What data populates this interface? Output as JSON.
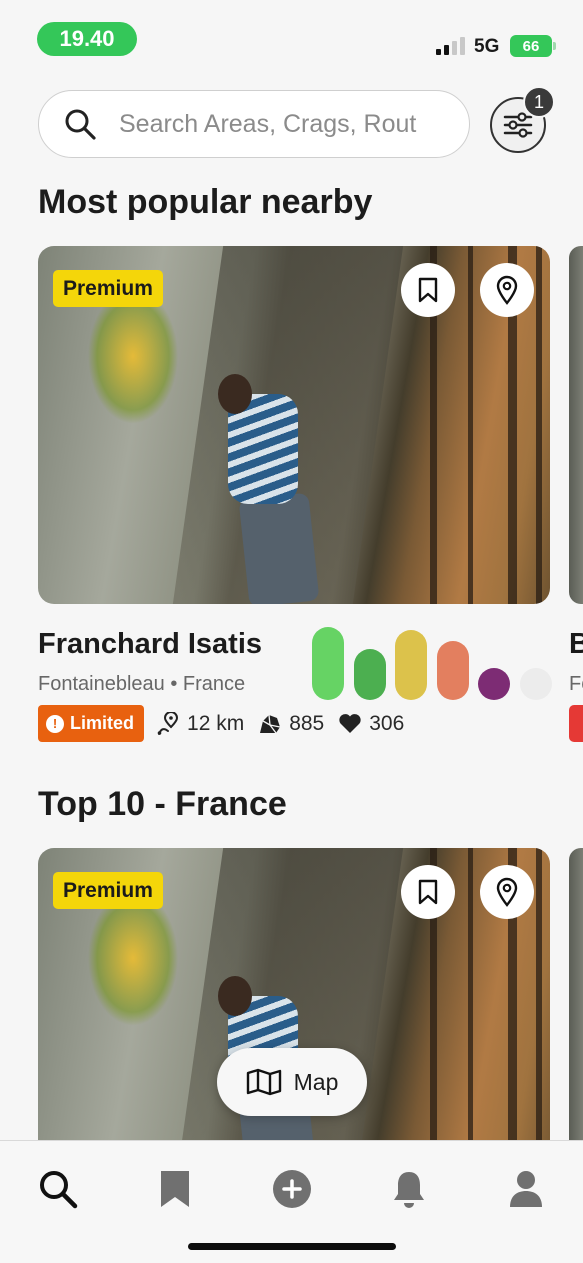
{
  "status_bar": {
    "time": "19.40",
    "network": "5G",
    "battery": "66"
  },
  "search": {
    "placeholder": "Search Areas, Crags, Rout",
    "filter_count": "1"
  },
  "sections": {
    "popular_title": "Most popular nearby",
    "top10_title": "Top 10 - France"
  },
  "card": {
    "premium_label": "Premium",
    "title": "Franchard Isatis",
    "subtitle": "Fontainebleau • France",
    "status_label": "Limited",
    "distance": "12 km",
    "boulders": "885",
    "likes": "306",
    "grade_distribution": [
      {
        "value": 0.96,
        "color": "#66d364"
      },
      {
        "value": 0.67,
        "color": "#4caf50"
      },
      {
        "value": 0.92,
        "color": "#dcc24b"
      },
      {
        "value": 0.78,
        "color": "#e37f5f"
      },
      {
        "value": 0.38,
        "color": "#7d2c74"
      },
      {
        "value": 0.38,
        "color": "#ececec"
      }
    ]
  },
  "peek_card": {
    "title": "B",
    "subtitle": "Fo"
  },
  "map_button": {
    "label": "Map"
  },
  "nav": [
    {
      "name": "search",
      "icon": "search-icon",
      "active": true
    },
    {
      "name": "saved",
      "icon": "bookmark-icon"
    },
    {
      "name": "add",
      "icon": "plus-circle-icon"
    },
    {
      "name": "notifications",
      "icon": "bell-icon"
    },
    {
      "name": "profile",
      "icon": "person-icon"
    }
  ]
}
